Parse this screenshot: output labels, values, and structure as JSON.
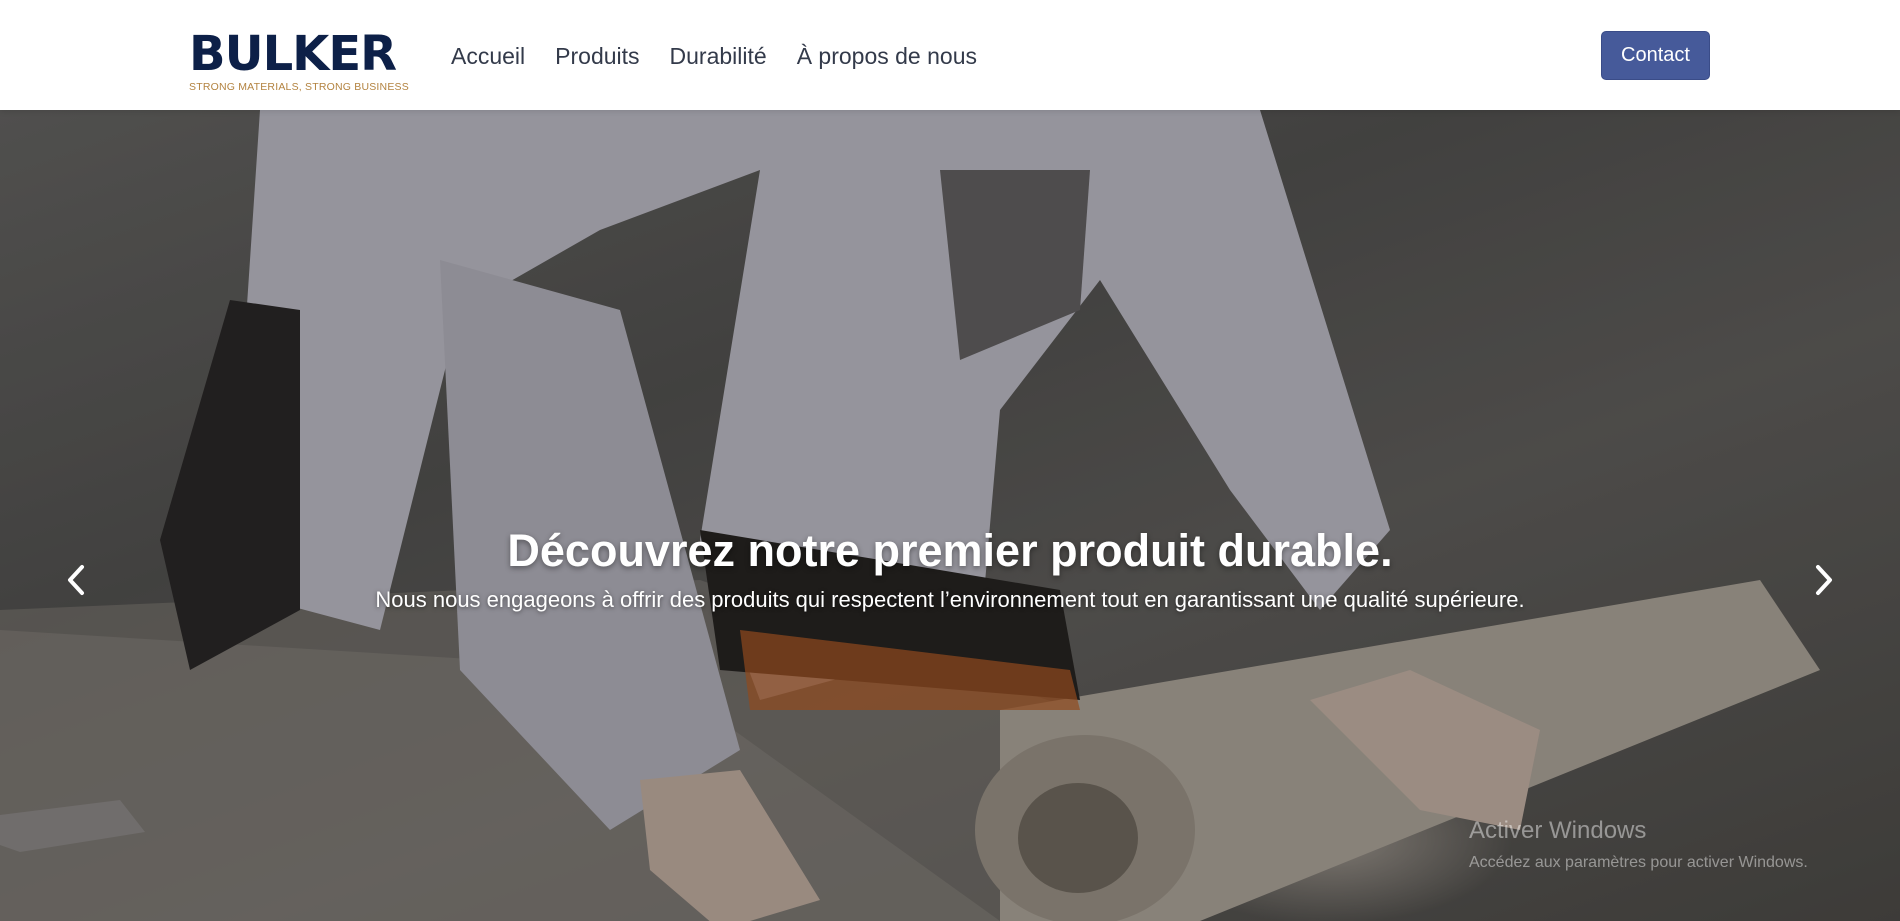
{
  "brand": {
    "name": "BULKER",
    "tagline": "STRONG MATERIALS, STRONG BUSINESS",
    "colors": {
      "navy": "#0d2048",
      "gold": "#b38340"
    }
  },
  "nav": {
    "items": [
      {
        "label": "Accueil"
      },
      {
        "label": "Produits"
      },
      {
        "label": "Durabilité"
      },
      {
        "label": "À propos de nous"
      }
    ],
    "contact_label": "Contact",
    "contact_color": "#465a9a"
  },
  "hero": {
    "title": "Découvrez notre premier produit durable.",
    "subtitle": "Nous nous engageons à offrir des produits qui respectent l’environnement tout en garantissant une qualité supérieure.",
    "prev_icon": "chevron-left-icon",
    "next_icon": "chevron-right-icon"
  },
  "watermark": {
    "title": "Activer Windows",
    "subtitle": "Accédez aux paramètres pour activer Windows."
  }
}
